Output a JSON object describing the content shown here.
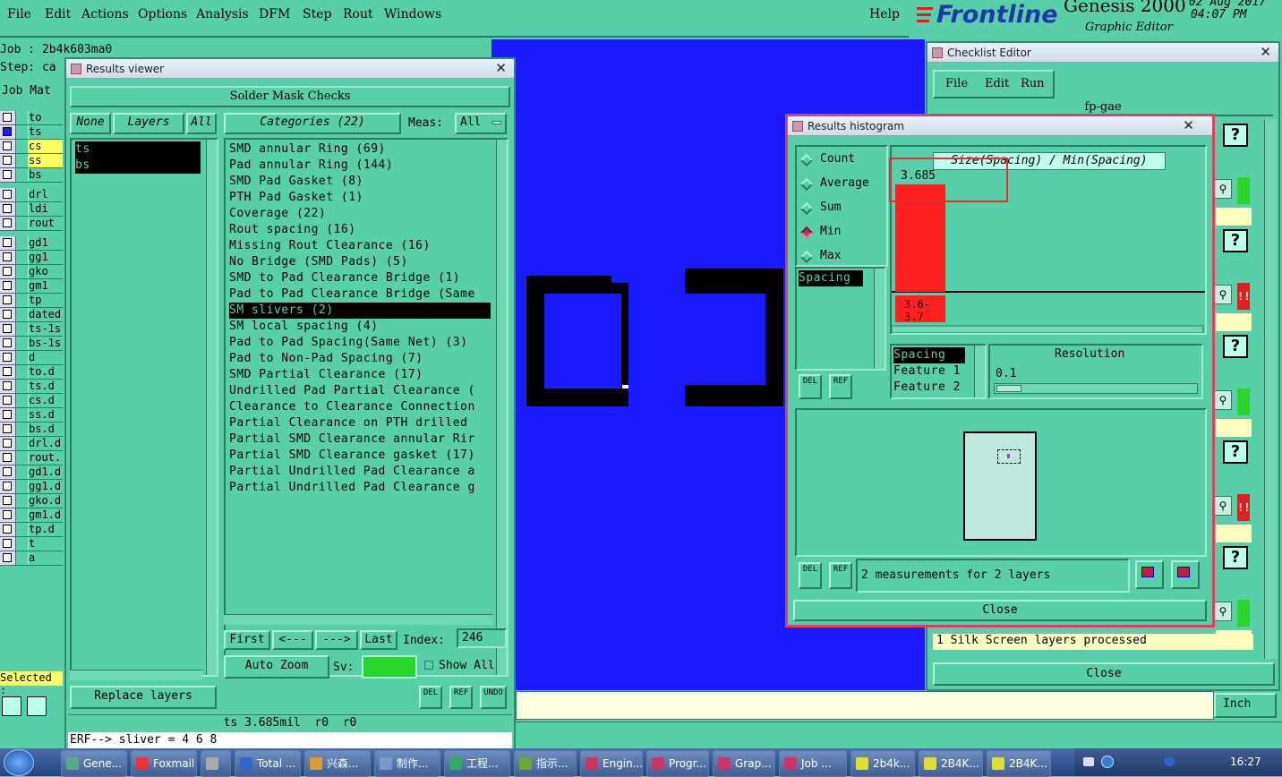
{
  "menubar": {
    "items": [
      "File",
      "Edit",
      "Actions",
      "Options",
      "Analysis",
      "DFM",
      "Step",
      "Rout",
      "Windows"
    ],
    "help": "Help"
  },
  "brand": {
    "logo": "Frontline",
    "product": "Genesis 2000",
    "subtitle": "Graphic Editor",
    "date": "02 Aug 2017",
    "time": "04:07 PM"
  },
  "job_panel": {
    "job_label": "Job : 2b4k603ma0",
    "step_label": "Step: ca",
    "matrix_label": "Job Mat",
    "layers": [
      "to",
      "ts",
      "cs",
      "ss",
      "bs",
      "drl",
      "ldi",
      "rout",
      "gd1",
      "gg1",
      "gko",
      "gm1",
      "tp",
      "dated",
      "ts-1s",
      "bs-1s",
      "d",
      "to.d",
      "ts.d",
      "cs.d",
      "ss.d",
      "bs.d",
      "drl.d",
      "rout.",
      "gd1.d",
      "gg1.d",
      "gko.d",
      "gm1.d",
      "tp.d",
      "t",
      "a"
    ],
    "selected_label": "Selected :"
  },
  "results_viewer": {
    "title": "Results viewer",
    "header": "Solder Mask Checks",
    "none_btn": "None",
    "layers_btn": "Layers",
    "all_btn": "All",
    "layer_list": [
      "ts",
      "bs"
    ],
    "categories_btn": "Categories (22)",
    "meas_label": "Meas:",
    "meas_value": "All",
    "categories": [
      "SMD annular Ring (69)",
      "Pad annular Ring (144)",
      "SMD Pad Gasket (8)",
      "PTH Pad Gasket (1)",
      "Coverage (22)",
      "Rout spacing (16)",
      "Missing Rout Clearance (16)",
      "No Bridge (SMD Pads) (5)",
      "SMD to Pad Clearance Bridge (1)",
      "Pad to Pad Clearance Bridge (Same",
      "SM slivers (2)",
      "SM local spacing (4)",
      "Pad to Pad Spacing(Same Net) (3)",
      "Pad to Non-Pad Spacing (7)",
      "SMD Partial Clearance (17)",
      "Undrilled Pad Partial Clearance (",
      "Clearance to Clearance Connection",
      "Partial Clearance on PTH drilled",
      "Partial SMD Clearance annular Rir",
      "Partial SMD Clearance gasket (17)",
      "Partial Undrilled Pad Clearance a",
      "Partial Undrilled Pad Clearance g"
    ],
    "selected_category_index": 10,
    "first_btn": "First",
    "prev_btn": "<---",
    "next_btn": "--->",
    "last_btn": "Last",
    "index_label": "Index:",
    "index_value": "246",
    "auto_zoom_btn": "Auto Zoom",
    "sv_label": "Sv:",
    "show_all_label": "Show All",
    "replace_layers_btn": "Replace layers",
    "del_btn": "DEL",
    "ref_btn": "REF",
    "undo_btn": "UNDO",
    "status_line": "ts 3.685mil  r0  r0",
    "erf_line": "ERF--> sliver = 4 6 8"
  },
  "histogram": {
    "title": "Results histogram",
    "options": [
      "Count",
      "Average",
      "Sum",
      "Min",
      "Max"
    ],
    "selected_option": "Min",
    "chart_title": "Size(Spacing) / Min(Spacing)",
    "bar_value_label": "3.685",
    "bar_range_label": "3.6-\n3.7",
    "measure_list": [
      "Spacing"
    ],
    "del_btn": "DEL",
    "ref_btn": "REF",
    "feature_list": [
      "Spacing",
      "Feature 1",
      "Feature 2"
    ],
    "resolution_label": "Resolution",
    "resolution_value": "0.1",
    "summary": "2 measurements for 2 layers",
    "close_btn": "Close"
  },
  "chart_data": {
    "type": "bar",
    "title": "Size(Spacing) / Min(Spacing)",
    "categories": [
      "3.6-3.7"
    ],
    "values": [
      3.685
    ]
  },
  "checklist": {
    "title": "Checklist Editor",
    "menu": [
      "File",
      "Edit",
      "Run"
    ],
    "name": "fp-gae",
    "status": "1 Silk Screen layers processed",
    "close_btn": "Close",
    "row_help": "?",
    "row_flag": "!!",
    "unit_btn": "Inch"
  },
  "taskbar": {
    "items": [
      "Gene...",
      "Foxmail",
      "",
      "Total ...",
      "兴森...",
      "制作...",
      "工程...",
      "指示...",
      "Engin...",
      "Progr...",
      "Grap...",
      "Job ...",
      "2b4k...",
      "2B4K...",
      "2B4K..."
    ],
    "clock": "16:27"
  },
  "colors": {
    "panel": "#59cfa9",
    "canvas": "#1a1aff",
    "bar": "#ff2020",
    "highlight_box": "#e03030"
  }
}
